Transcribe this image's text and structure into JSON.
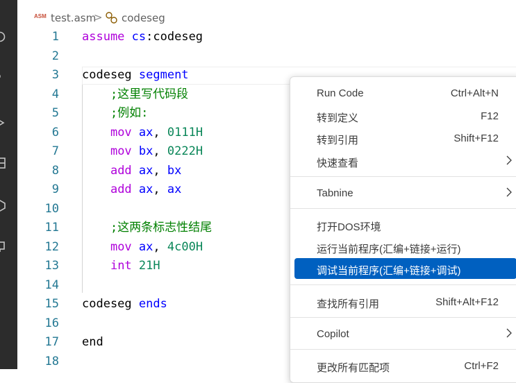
{
  "breadcrumb": {
    "file_badge": "ASM",
    "file_name": "test.asm",
    "separator": ">",
    "symbol_name": "codeseg"
  },
  "editor": {
    "line_numbers": [
      "1",
      "2",
      "3",
      "4",
      "5",
      "6",
      "7",
      "8",
      "9",
      "10",
      "11",
      "12",
      "13",
      "14",
      "15",
      "16",
      "17",
      "18"
    ],
    "lines": [
      [
        {
          "t": "assume",
          "c": "k"
        },
        {
          "t": " ",
          "c": ""
        },
        {
          "t": "cs",
          "c": "v"
        },
        {
          "t": ":codeseg",
          "c": ""
        }
      ],
      [],
      [
        {
          "t": "codeseg ",
          "c": ""
        },
        {
          "t": "segment",
          "c": "v"
        }
      ],
      [
        {
          "t": "    ;这里写代码段",
          "c": "c"
        }
      ],
      [
        {
          "t": "    ;例如:",
          "c": "c"
        }
      ],
      [
        {
          "t": "    ",
          "c": ""
        },
        {
          "t": "mov",
          "c": "k"
        },
        {
          "t": " ",
          "c": ""
        },
        {
          "t": "ax",
          "c": "v"
        },
        {
          "t": ", ",
          "c": ""
        },
        {
          "t": "0111H",
          "c": "n"
        }
      ],
      [
        {
          "t": "    ",
          "c": ""
        },
        {
          "t": "mov",
          "c": "k"
        },
        {
          "t": " ",
          "c": ""
        },
        {
          "t": "bx",
          "c": "v"
        },
        {
          "t": ", ",
          "c": ""
        },
        {
          "t": "0222H",
          "c": "n"
        }
      ],
      [
        {
          "t": "    ",
          "c": ""
        },
        {
          "t": "add",
          "c": "k"
        },
        {
          "t": " ",
          "c": ""
        },
        {
          "t": "ax",
          "c": "v"
        },
        {
          "t": ", ",
          "c": ""
        },
        {
          "t": "bx",
          "c": "v"
        }
      ],
      [
        {
          "t": "    ",
          "c": ""
        },
        {
          "t": "add",
          "c": "k"
        },
        {
          "t": " ",
          "c": ""
        },
        {
          "t": "ax",
          "c": "v"
        },
        {
          "t": ", ",
          "c": ""
        },
        {
          "t": "ax",
          "c": "v"
        }
      ],
      [],
      [
        {
          "t": "    ;这两条标志性结尾",
          "c": "c"
        }
      ],
      [
        {
          "t": "    ",
          "c": ""
        },
        {
          "t": "mov",
          "c": "k"
        },
        {
          "t": " ",
          "c": ""
        },
        {
          "t": "ax",
          "c": "v"
        },
        {
          "t": ", ",
          "c": ""
        },
        {
          "t": "4c00H",
          "c": "n"
        }
      ],
      [
        {
          "t": "    ",
          "c": ""
        },
        {
          "t": "int",
          "c": "k"
        },
        {
          "t": " ",
          "c": ""
        },
        {
          "t": "21H",
          "c": "n"
        }
      ],
      [],
      [
        {
          "t": "codeseg ",
          "c": ""
        },
        {
          "t": "ends",
          "c": "v"
        }
      ],
      [],
      [
        {
          "t": "end",
          "c": ""
        }
      ],
      []
    ]
  },
  "context_menu": {
    "items": [
      {
        "label": "Run Code",
        "key": "Ctrl+Alt+N"
      },
      {
        "label": "转到定义",
        "key": "F12"
      },
      {
        "label": "转到引用",
        "key": "Shift+F12"
      },
      {
        "label": "快速查看",
        "key": ""
      },
      {
        "label": "Tabnine",
        "key": ""
      },
      {
        "label": "打开DOS环境",
        "key": ""
      },
      {
        "label": "运行当前程序(汇编+链接+运行)",
        "key": ""
      },
      {
        "label": "调试当前程序(汇编+链接+调试)",
        "key": ""
      },
      {
        "label": "查找所有引用",
        "key": "Shift+Alt+F12"
      },
      {
        "label": "Copilot",
        "key": ""
      },
      {
        "label": "更改所有匹配项",
        "key": "Ctrl+F2"
      }
    ]
  },
  "colors": {
    "activity_bar": "#2c2c2c",
    "line_number": "#237893",
    "keyword": "#af00db",
    "register": "#0000ff",
    "number": "#098658",
    "comment": "#008000",
    "menu_highlight": "#0060c0"
  },
  "icons": [
    "search-icon",
    "source-control-icon",
    "run-debug-icon",
    "extensions-icon",
    "package-icon",
    "remote-icon",
    "symbol-icon",
    "chevron-right-icon"
  ]
}
